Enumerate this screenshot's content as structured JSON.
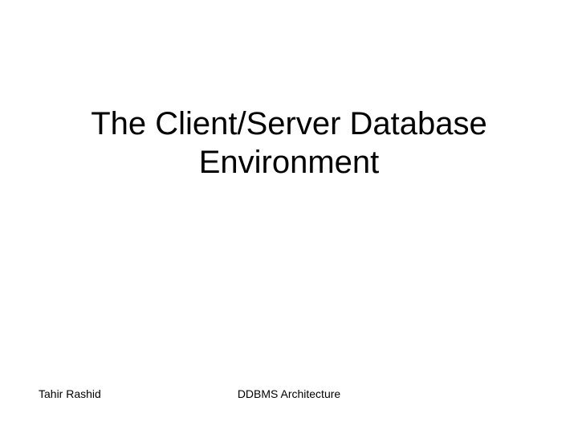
{
  "slide": {
    "title": "The Client/Server Database Environment",
    "footer_left": "Tahir Rashid",
    "footer_center": "DDBMS Architecture"
  }
}
